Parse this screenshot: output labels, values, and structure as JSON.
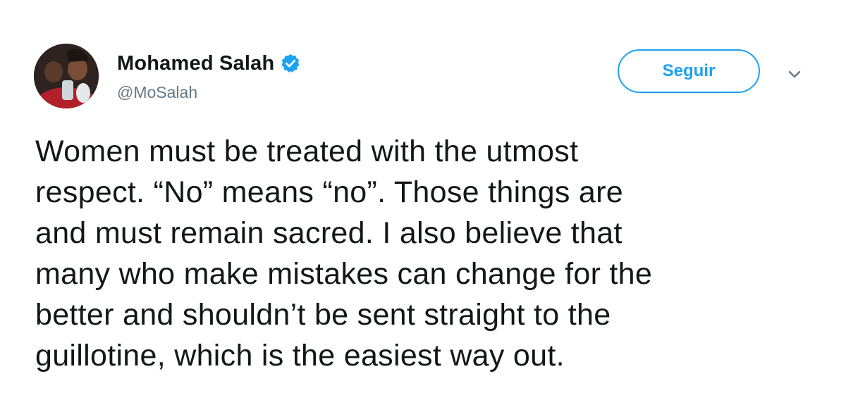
{
  "user": {
    "display_name": "Mohamed Salah",
    "handle": "@MoSalah",
    "verified": true,
    "avatar": "avatar-photo"
  },
  "actions": {
    "follow_label": "Seguir",
    "menu_icon": "chevron-down-icon"
  },
  "tweet": {
    "text": "Women must be treated with the utmost\nrespect. “No” means “no”. Those things are\nand must remain sacred. I also believe that\nmany who make mistakes can change for the\nbetter and shouldn’t be sent straight to the\nguillotine, which is the easiest way out."
  },
  "colors": {
    "accent": "#1da1f2",
    "text": "#14171a",
    "secondary": "#657786"
  }
}
